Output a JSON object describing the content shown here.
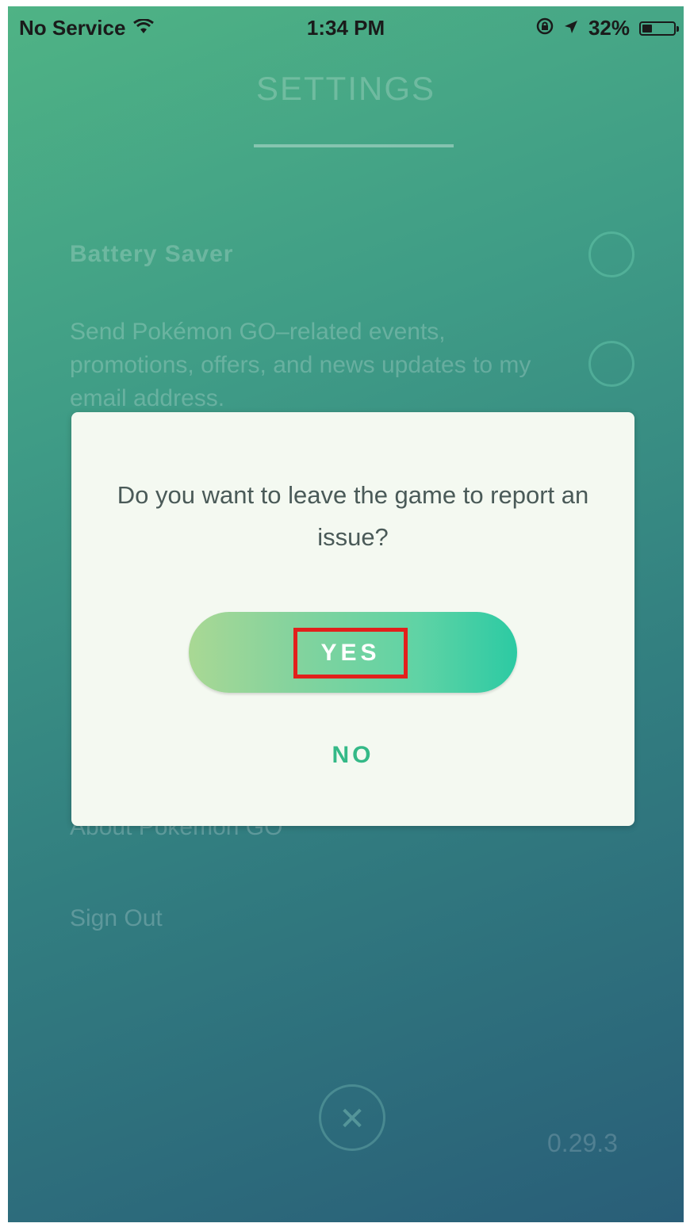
{
  "status_bar": {
    "carrier": "No Service",
    "time": "1:34 PM",
    "battery": "32%",
    "battery_level": 0.32,
    "icons": [
      "wifi-icon",
      "lock-rotation-icon",
      "location-arrow-icon",
      "battery-icon"
    ]
  },
  "settings": {
    "title": "SETTINGS",
    "battery_saver_label": "Battery Saver",
    "email_opt_in_label": "Send Pokémon GO–related events, promotions, offers, and news updates to my email address.",
    "about_label": "About Pokémon GO",
    "sign_out_label": "Sign Out",
    "version": "0.29.3",
    "close_icon": "close-icon"
  },
  "dialog": {
    "message": "Do you want to leave the game to report an issue?",
    "yes_label": "YES",
    "no_label": "NO"
  },
  "colors": {
    "highlight_box": "#e2201c",
    "no_button_text": "#34b987",
    "dialog_background": "#f4f9f1"
  }
}
